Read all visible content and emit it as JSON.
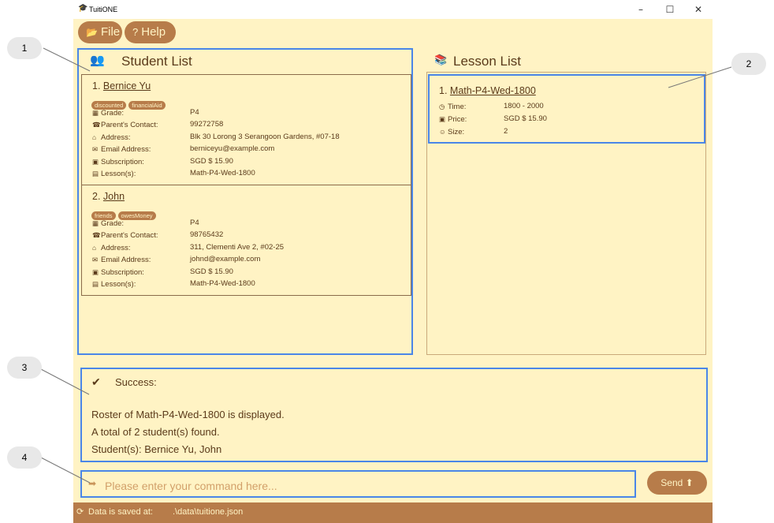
{
  "app": {
    "title": "TuitiONE",
    "cap_icon": "graduation-cap-icon"
  },
  "window_controls": {
    "minimize": "–",
    "maximize": "☐",
    "close": "✕"
  },
  "menu": {
    "file_label": "File",
    "help_label": "Help"
  },
  "student_panel": {
    "title": "Student List",
    "students": [
      {
        "index": "1.",
        "name": "Bernice Yu",
        "tags": [
          "discounted",
          "financialAid"
        ],
        "fields": [
          {
            "icon": "grade-icon",
            "label": "Grade:",
            "value": "P4"
          },
          {
            "icon": "phone-icon",
            "label": "Parent's Contact:",
            "value": "99272758"
          },
          {
            "icon": "home-icon",
            "label": "Address:",
            "value": "Blk 30 Lorong 3 Serangoon Gardens, #07-18"
          },
          {
            "icon": "email-icon",
            "label": "Email Address:",
            "value": "berniceyu@example.com"
          },
          {
            "icon": "money-icon",
            "label": "Subscription:",
            "value": "SGD $ 15.90"
          },
          {
            "icon": "book-icon",
            "label": "Lesson(s):",
            "value": "Math-P4-Wed-1800"
          }
        ]
      },
      {
        "index": "2.",
        "name": "John",
        "tags": [
          "friends",
          "owesMoney"
        ],
        "fields": [
          {
            "icon": "grade-icon",
            "label": "Grade:",
            "value": "P4"
          },
          {
            "icon": "phone-icon",
            "label": "Parent's Contact:",
            "value": "98765432"
          },
          {
            "icon": "home-icon",
            "label": "Address:",
            "value": "311, Clementi Ave 2, #02-25"
          },
          {
            "icon": "email-icon",
            "label": "Email Address:",
            "value": "johnd@example.com"
          },
          {
            "icon": "money-icon",
            "label": "Subscription:",
            "value": "SGD $ 15.90"
          },
          {
            "icon": "book-icon",
            "label": "Lesson(s):",
            "value": "Math-P4-Wed-1800"
          }
        ]
      }
    ]
  },
  "lesson_panel": {
    "title": "Lesson List",
    "lessons": [
      {
        "index": "1.",
        "name": "Math-P4-Wed-1800",
        "fields": [
          {
            "icon": "clock-icon",
            "label": "Time:",
            "value": "1800 - 2000"
          },
          {
            "icon": "money-icon",
            "label": "Price:",
            "value": "SGD $ 15.90"
          },
          {
            "icon": "smiley-icon",
            "label": "Size:",
            "value": "2"
          }
        ]
      }
    ]
  },
  "result": {
    "status": "Success:",
    "lines": [
      "Roster of Math-P4-Wed-1800 is displayed.",
      "A total of 2 student(s) found.",
      "Student(s): Bernice Yu, John"
    ]
  },
  "command": {
    "placeholder": "Please enter your command here...",
    "value": ""
  },
  "send_label": "Send",
  "status_bar": {
    "label": "Data is saved at:",
    "path": ".\\data\\tuitione.json"
  },
  "callouts": [
    "1",
    "2",
    "3",
    "4"
  ],
  "colors": {
    "background": "#fff3c4",
    "accent": "#b77c4a",
    "text": "#5a3a1a",
    "highlight": "#4a86e8"
  }
}
